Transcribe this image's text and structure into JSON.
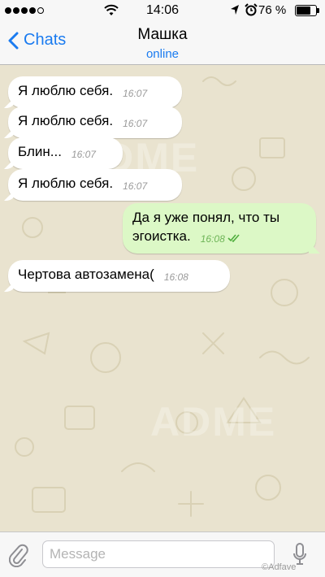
{
  "status_bar": {
    "time": "14:06",
    "battery_percent": "76 %",
    "battery_level": 0.76,
    "signal_bars_filled": 4,
    "signal_bars_total": 5,
    "icons": [
      "wifi-icon",
      "location-arrow-icon",
      "alarm-icon"
    ]
  },
  "nav": {
    "back_label": "Chats",
    "contact_name": "Машка",
    "contact_status": "online"
  },
  "messages": [
    {
      "direction": "in",
      "text": "Я люблю себя.",
      "time": "16:07"
    },
    {
      "direction": "in",
      "text": "Я люблю себя.",
      "time": "16:07"
    },
    {
      "direction": "in",
      "text": "Блин...",
      "time": "16:07"
    },
    {
      "direction": "in",
      "text": "Я люблю себя.",
      "time": "16:07"
    },
    {
      "direction": "out",
      "text": "Да я уже понял, что ты эгоистка.",
      "time": "16:08",
      "read": true
    },
    {
      "direction": "in",
      "text": "Чертова автозамена(",
      "time": "16:08"
    }
  ],
  "composer": {
    "placeholder": "Message",
    "value": ""
  },
  "watermark": "ADME",
  "credit": "©Adfave",
  "colors": {
    "accent": "#1a7bf0",
    "outgoing_bubble": "#dcf8c6",
    "incoming_bubble": "#ffffff",
    "wallpaper": "#e9e3cf"
  }
}
